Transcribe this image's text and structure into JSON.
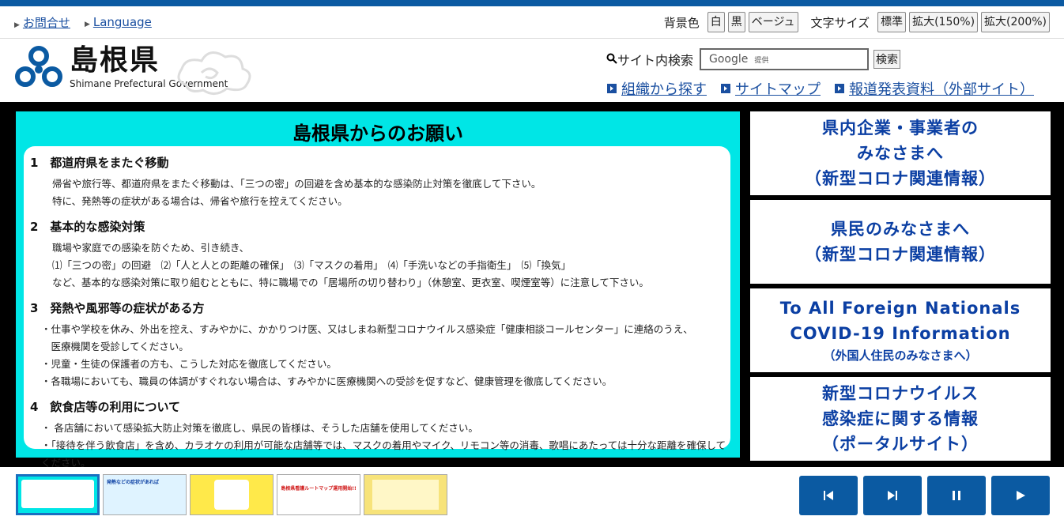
{
  "utility": {
    "contact": "お問合せ",
    "language": "Language",
    "bg_label": "背景色",
    "bg_white": "白",
    "bg_black": "黒",
    "bg_beige": "ベージュ",
    "size_label": "文字サイズ",
    "size_std": "標準",
    "size_150": "拡大(150%)",
    "size_200": "拡大(200%)"
  },
  "header": {
    "title": "島根県",
    "subtitle": "Shimane Prefectural Government",
    "search_label": "サイト内検索",
    "search_placeholder": "Google",
    "search_provided": "提供",
    "search_button": "検索",
    "links": [
      "組織から探す",
      "サイトマップ",
      "報道発表資料（外部サイト）"
    ]
  },
  "slide": {
    "title": "島根県からのお願い",
    "sections": [
      {
        "heading": "1　都道府県をまたぐ移動",
        "lines": [
          "帰省や旅行等、都道府県をまたぐ移動は、「三つの密」の回避を含め基本的な感染防止対策を徹底して下さい。",
          "特に、発熱等の症状がある場合は、帰省や旅行を控えてください。"
        ]
      },
      {
        "heading": "2　基本的な感染対策",
        "lines": [
          "職場や家庭での感染を防ぐため、引き続き、",
          "⑴「三つの密」の回避　⑵「人と人との距離の確保」　⑶「マスクの着用」　⑷「手洗いなどの手指衛生」　⑸「換気」",
          "など、基本的な感染対策に取り組むとともに、特に職場での「居場所の切り替わり」（休憩室、更衣室、喫煙室等）に注意して下さい。"
        ]
      },
      {
        "heading": "3　発熱や風邪等の症状がある方",
        "lines": [
          "・仕事や学校を休み、外出を控え、すみやかに、かかりつけ医、又はしまね新型コロナウイルス感染症「健康相談コールセンター」に連絡のうえ、",
          "　医療機関を受診してください。",
          "・児童・生徒の保護者の方も、こうした対応を徹底してください。",
          "・各職場においても、職員の体調がすぐれない場合は、すみやかに医療機関への受診を促すなど、健康管理を徹底してください。"
        ]
      },
      {
        "heading": "4　飲食店等の利用について",
        "lines": [
          "・ 各店舗において感染拡大防止対策を徹底し、県民の皆様は、そうした店舗を使用してください。",
          "・「接待を伴う飲食店」を含め、カラオケの利用が可能な店舗等では、マスクの着用やマイク、リモコン等の消毒、歌唱にあたっては十分な距離を確保してください。"
        ]
      }
    ]
  },
  "banners": [
    {
      "lines": [
        "県内企業・事業者の",
        "みなさまへ",
        "（新型コロナ関連情報）"
      ]
    },
    {
      "lines": [
        "県民のみなさまへ",
        "（新型コロナ関連情報）"
      ]
    },
    {
      "lines": [
        "To All Foreign Nationals",
        "COVID-19 Information"
      ],
      "sub": "（外国人住民のみなさまへ）"
    },
    {
      "lines": [
        "新型コロナウイルス",
        "感染症に関する情報",
        "（ポータルサイト）"
      ]
    }
  ],
  "thumbnails": [
    {
      "name": "thumb-1",
      "color": "#00e6e6"
    },
    {
      "name": "thumb-2",
      "color": "#dff3ff",
      "text": "発熱などの症状があれば"
    },
    {
      "name": "thumb-3",
      "color": "#ffe94a"
    },
    {
      "name": "thumb-4",
      "color": "#ffffff",
      "text": "島根県看護ルートマップ運用開始!!"
    },
    {
      "name": "thumb-5",
      "color": "#f7e37a"
    }
  ],
  "colors": {
    "brand": "#0b5aa2",
    "slide_bg": "#00e6e6",
    "banner_text": "#0b3fa3"
  }
}
